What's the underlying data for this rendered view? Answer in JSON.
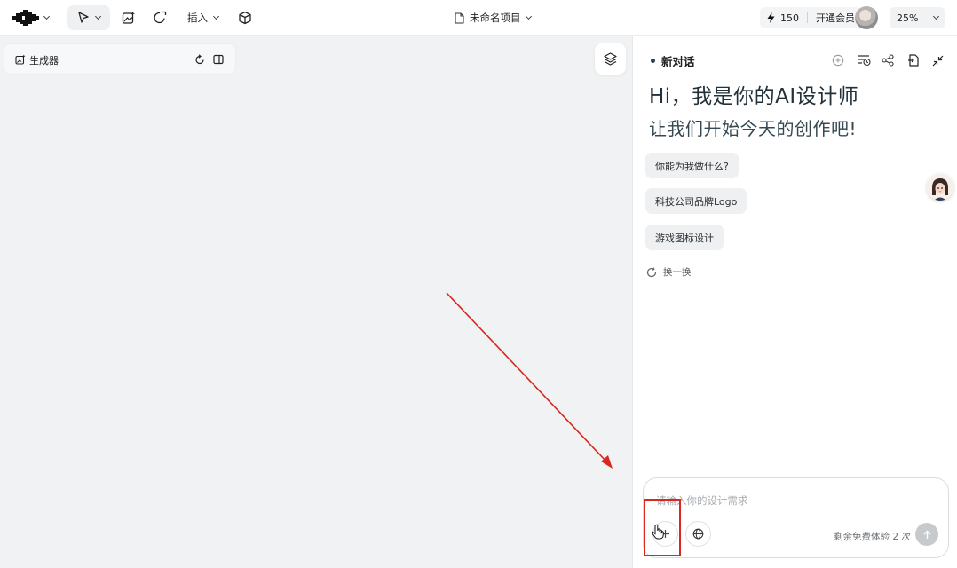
{
  "toolbar": {
    "insert_label": "插入",
    "project_title": "未命名项目",
    "credits": "150",
    "membership_label": "开通会员",
    "zoom": "25%"
  },
  "canvas": {
    "generator_label": "生成器"
  },
  "chat": {
    "heading": "新对话",
    "greeting_line1": "Hi，我是你的AI设计师",
    "greeting_line2": "让我们开始今天的创作吧!",
    "suggestions": [
      "你能为我做什么?",
      "科技公司品牌Logo",
      "游戏图标设计"
    ],
    "refresh_label": "换一换",
    "input_placeholder": "请输入你的设计需求",
    "remaining_text": "剩余免费体验 2 次"
  },
  "colors": {
    "annotation_red": "#d8281f",
    "canvas_bg": "#f1f2f4",
    "accent_dark": "#22313a"
  },
  "icons": [
    "logo-icon",
    "cursor-arrow-icon",
    "image-edit-icon",
    "shape-icon",
    "cube-icon",
    "document-icon",
    "lightning-icon",
    "avatar",
    "chevron-down-icon",
    "generator-icon",
    "reset-icon",
    "panel-icon",
    "layers-icon",
    "add-chat-icon",
    "history-icon",
    "share-icon",
    "export-icon",
    "collapse-icon",
    "refresh-icon",
    "plus-icon",
    "globe-icon",
    "send-icon",
    "hand-cursor-icon"
  ]
}
